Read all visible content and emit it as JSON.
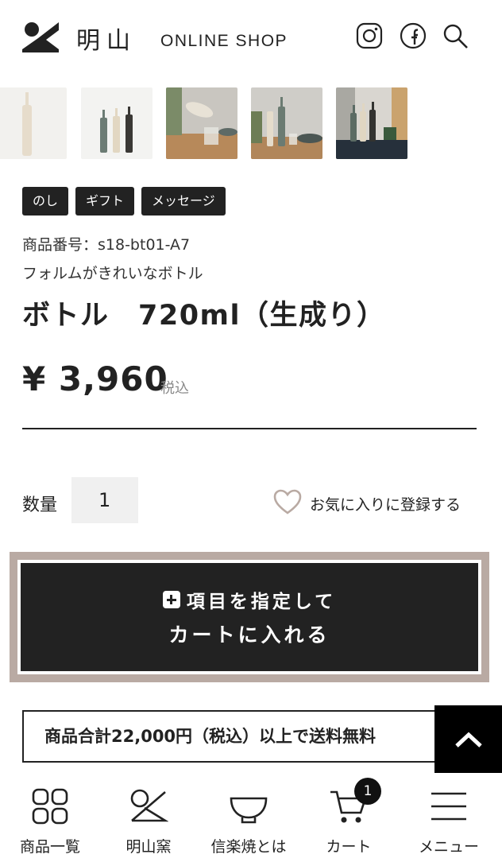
{
  "header": {
    "logo_kanji": "明山",
    "logo_sub": "ONLINE SHOP",
    "icons": [
      "instagram-icon",
      "facebook-icon",
      "search-icon"
    ]
  },
  "thumbnails": [
    {
      "alt": "bottle-cream"
    },
    {
      "alt": "three-bottles"
    },
    {
      "alt": "pouring-glass"
    },
    {
      "alt": "bottle-with-bowl"
    },
    {
      "alt": "bottles-on-shelf"
    }
  ],
  "tags": [
    "のし",
    "ギフト",
    "メッセージ"
  ],
  "product": {
    "number": "商品番号：s18-bt01-A7",
    "description": "フォルムがきれいなボトル",
    "title": "ボトル　720ml（生成り）",
    "price": "¥ 3,960",
    "tax": "税込"
  },
  "quantity": {
    "label": "数量",
    "value": "1"
  },
  "favorite": {
    "label": "お気に入りに登録する"
  },
  "cart_button": {
    "line1": "項目を指定して",
    "line2": "カートに入れる"
  },
  "shipping_banner": "商品合計22,000円（税込）以上で送料無料",
  "bottom_nav": {
    "items": [
      {
        "label": "商品一覧",
        "icon": "grid-icon"
      },
      {
        "label": "明山窯",
        "icon": "kiln-logo-icon"
      },
      {
        "label": "信楽焼とは",
        "icon": "bowl-icon"
      },
      {
        "label": "カート",
        "icon": "cart-icon"
      },
      {
        "label": "メニュー",
        "icon": "hamburger-icon"
      }
    ],
    "cart_badge": "1"
  },
  "colors": {
    "dark": "#222222",
    "accent_border": "#b9aaa3",
    "heart": "#b9aaa3"
  }
}
